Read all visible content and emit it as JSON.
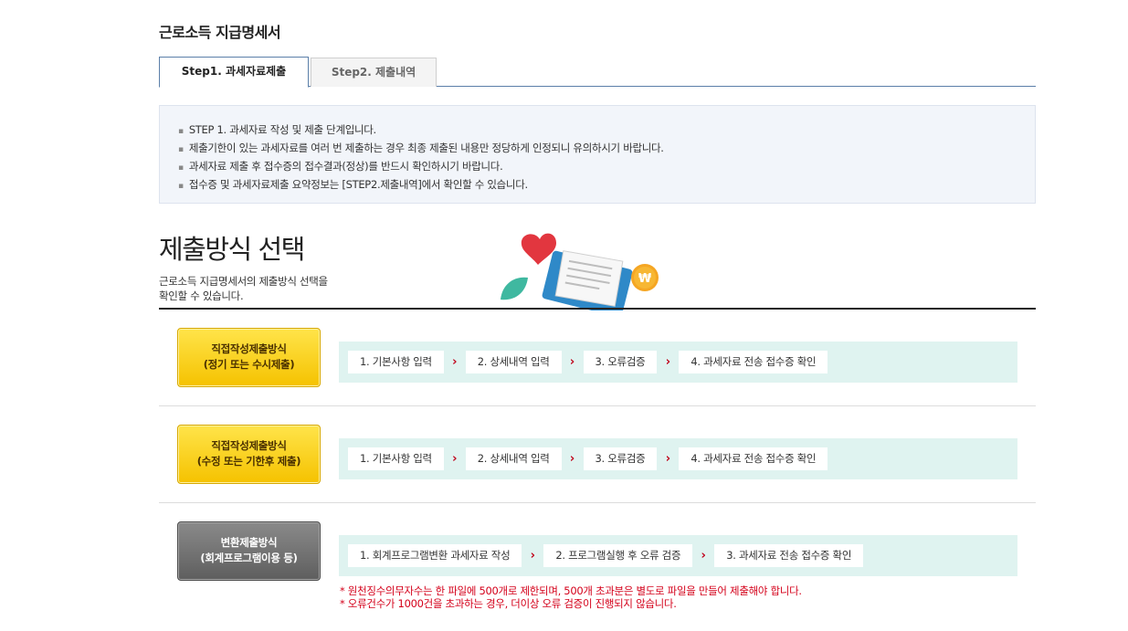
{
  "page": {
    "title": "근로소득 지급명세서"
  },
  "tabs": [
    {
      "label": "Step1. 과세자료제출",
      "active": true
    },
    {
      "label": "Step2. 제출내역",
      "active": false
    }
  ],
  "notice": {
    "items": [
      "STEP 1. 과세자료 작성 및 제출 단계입니다.",
      "제출기한이 있는 과세자료를 여러 번 제출하는 경우 최종 제출된 내용만 정당하게 인정되니 유의하시기 바랍니다.",
      "과세자료 제출 후 접수증의 접수결과(정상)를 반드시 확인하시기 바랍니다.",
      "접수증 및 과세자료제출 요약정보는 [STEP2.제출내역]에서 확인할 수 있습니다."
    ]
  },
  "section": {
    "title": "제출방식 선택",
    "desc_line1": "근로소득 지급명세서의 제출방식 선택을",
    "desc_line2": "확인할 수 있습니다."
  },
  "methods": [
    {
      "line1": "직접작성제출방식",
      "line2": "(정기 또는 수시제출)",
      "style": "yellow",
      "steps": [
        "1. 기본사항 입력",
        "2. 상세내역 입력",
        "3. 오류검증",
        "4. 과세자료 전송 접수증 확인"
      ]
    },
    {
      "line1": "직접작성제출방식",
      "line2": "(수정 또는 기한후 제출)",
      "style": "yellow",
      "steps": [
        "1. 기본사항 입력",
        "2. 상세내역 입력",
        "3. 오류검증",
        "4. 과세자료 전송 접수증 확인"
      ]
    },
    {
      "line1": "변환제출방식",
      "line2": "(회계프로그램이용 등)",
      "style": "gray",
      "steps": [
        "1. 회계프로그램변환 과세자료 작성",
        "2. 프로그램실행 후 오류 검증",
        "3. 과세자료 전송 접수증 확인"
      ]
    }
  ],
  "arrow_glyph": "›",
  "warnings": [
    "* 원천징수의무자수는 한 파일에 500개로 제한되며, 500개 초과분은 별도로 파일을 만들어 제출해야 합니다.",
    "* 오류건수가 1000건을 초과하는 경우, 더이상 오류 검증이 진행되지 않습니다."
  ],
  "colors": {
    "accent_blue": "#5b7fa9",
    "flow_bg": "#dff3f0",
    "arrow_red": "#c0001a",
    "warn_red": "#d4001a",
    "btn_yellow": "#f5c200",
    "btn_gray": "#6b6b6b"
  }
}
